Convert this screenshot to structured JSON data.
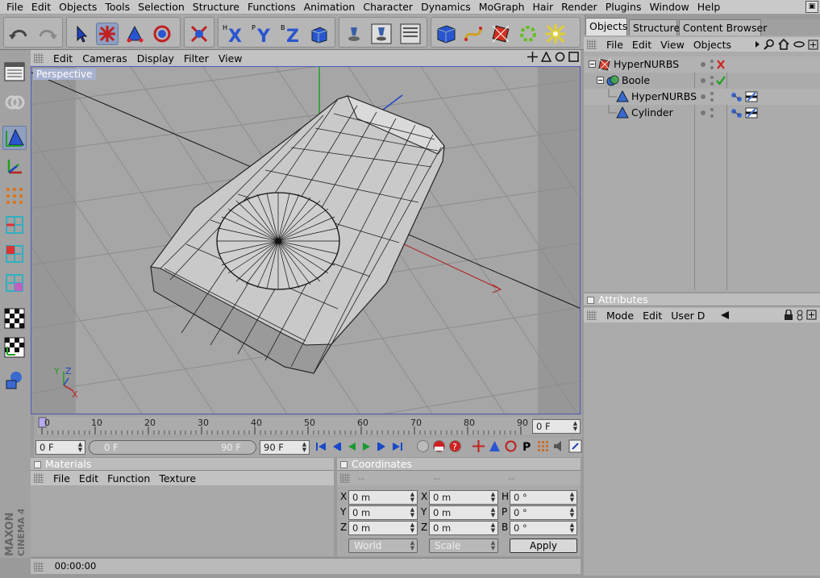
{
  "menu": [
    "File",
    "Edit",
    "Objects",
    "Tools",
    "Selection",
    "Structure",
    "Functions",
    "Animation",
    "Character",
    "Dynamics",
    "MoGraph",
    "Hair",
    "Render",
    "Plugins",
    "Window",
    "Help"
  ],
  "viewport": {
    "menu": [
      "Edit",
      "Cameras",
      "Display",
      "Filter",
      "View"
    ],
    "label": "Perspective",
    "axis_x": "X",
    "axis_y": "Y",
    "axis_z": "Z"
  },
  "timeline": {
    "ticks": [
      "0",
      "10",
      "20",
      "30",
      "40",
      "50",
      "60",
      "70",
      "80",
      "90"
    ],
    "current_frame": "0 F"
  },
  "playback": {
    "start_frame": "0 F",
    "slider_start": "0 F",
    "slider_end": "90 F",
    "end_frame": "90 F"
  },
  "materials": {
    "title": "Materials",
    "menu": [
      "File",
      "Edit",
      "Function",
      "Texture"
    ]
  },
  "coordinates": {
    "title": "Coordinates",
    "headers": [
      "--",
      "--",
      "--"
    ],
    "rows": [
      {
        "axis1": "X",
        "pos": "0 m",
        "axis2": "X",
        "size": "0 m",
        "axis3": "H",
        "rot": "0 °"
      },
      {
        "axis1": "Y",
        "pos": "0 m",
        "axis2": "Y",
        "size": "0 m",
        "axis3": "P",
        "rot": "0 °"
      },
      {
        "axis1": "Z",
        "pos": "0 m",
        "axis2": "Z",
        "size": "0 m",
        "axis3": "B",
        "rot": "0 °"
      }
    ],
    "space": "World",
    "mode": "Scale",
    "apply": "Apply"
  },
  "status": {
    "time": "00:00:00"
  },
  "right_tabs": [
    "Objects",
    "Structure",
    "Content Browser"
  ],
  "objects": {
    "menu": [
      "File",
      "Edit",
      "View",
      "Objects"
    ],
    "items": [
      {
        "name": "HyperNURBS",
        "level": 0
      },
      {
        "name": "Boole",
        "level": 1
      },
      {
        "name": "HyperNURBS",
        "level": 2
      },
      {
        "name": "Cylinder",
        "level": 2
      }
    ]
  },
  "attributes": {
    "title": "Attributes",
    "menu": [
      "Mode",
      "Edit",
      "User D"
    ]
  },
  "brand": {
    "maker": "MAXON",
    "product": "CINEMA 4D"
  },
  "colors": {
    "accent": "#4a5dbb",
    "selection": "#8e9fc0"
  }
}
